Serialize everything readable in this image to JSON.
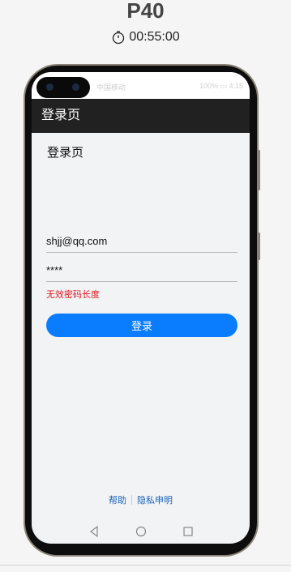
{
  "device": {
    "name": "P40",
    "timer": "00:55:00"
  },
  "status_bar": {
    "left": "中国移动",
    "right": "100% ▭ 4:15"
  },
  "app_bar": {
    "title": "登录页"
  },
  "page": {
    "heading": "登录页"
  },
  "form": {
    "email_value": "shjj@qq.com",
    "password_value": "****",
    "error_message": "无效密码长度",
    "login_label": "登录"
  },
  "footer": {
    "help_label": "帮助",
    "privacy_label": "隐私申明"
  },
  "nav": {
    "back_icon": "back-triangle-icon",
    "home_icon": "home-circle-icon",
    "recent_icon": "recent-square-icon"
  },
  "colors": {
    "accent": "#0a7cfe",
    "error": "#e0191f",
    "app_bar": "#212121",
    "link": "#1a61b8"
  }
}
